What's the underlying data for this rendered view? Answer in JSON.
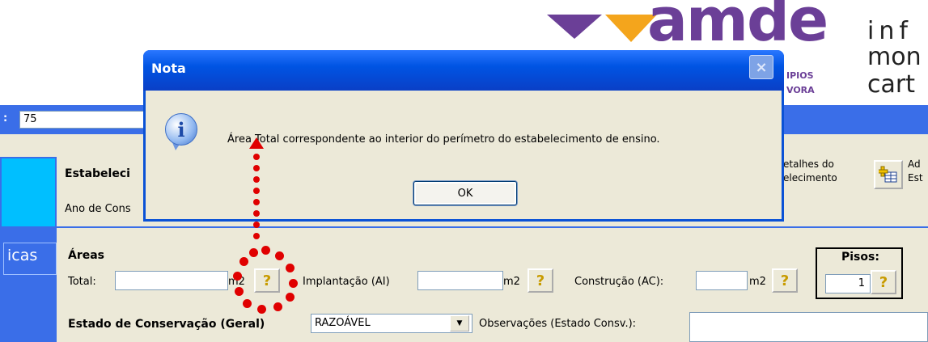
{
  "header": {
    "logo_word": "amde",
    "logo_sub1": "IPIOS",
    "logo_sub2": "VORA",
    "tagline_1": "inf",
    "tagline_2": "mon",
    "tagline_3": "cart",
    "colors": {
      "brand_purple": "#6b3f97",
      "brand_orange": "#f4a51c"
    }
  },
  "id_bar": {
    "colon": ":",
    "value": "75"
  },
  "nav": {
    "section_label": "icas"
  },
  "estabelecimento": {
    "title": "Estabeleci",
    "ano_label": "Ano de Cons",
    "details_line1": "etalhes do",
    "details_line2": "elecimento",
    "add_icon": "add-table-icon",
    "add_line1": "Ad",
    "add_line2": "Est"
  },
  "areas": {
    "title": "Áreas",
    "total_label": "Total:",
    "total_value": "",
    "total_unit": "m2",
    "implantacao_label": "Implantação (AI)",
    "implantacao_value": "",
    "implantacao_unit": "m2",
    "construcao_label": "Construção (AC):",
    "construcao_value": "",
    "construcao_unit": "m2",
    "help_glyph": "?",
    "pisos_label": "Pisos:",
    "pisos_value": "1"
  },
  "estado": {
    "label": "Estado de Conservação (Geral)",
    "selected": "RAZOÁVEL",
    "dropdown_glyph": "▼",
    "observacoes_label": "Observações (Estado Consv.):",
    "observacoes_value": ""
  },
  "dialog": {
    "title": "Nota",
    "close_glyph": "×",
    "icon": "info-icon",
    "icon_glyph": "i",
    "message": "Área Total correspondente ao interior do perímetro do estabelecimento de ensino.",
    "ok_label": "OK"
  },
  "annotation": {
    "color": "#e00000"
  }
}
